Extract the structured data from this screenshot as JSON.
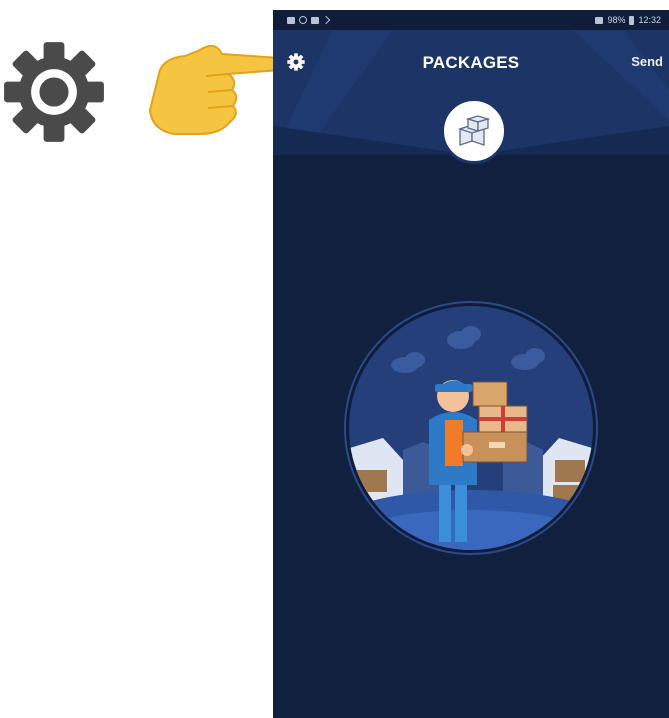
{
  "annotation": {
    "pointer_icon": "pointing-hand-icon",
    "gear_icon": "gear-icon",
    "hand_color": "#f5c542",
    "gear_color": "#4a4a4a"
  },
  "status_bar": {
    "time": "12:32",
    "battery": "98%"
  },
  "header": {
    "title": "PACKAGES",
    "send_label": "Send",
    "settings_icon": "gear-icon",
    "logo_icon": "boxes-icon"
  },
  "colors": {
    "background": "#122040",
    "header": "#1c3566",
    "accent": "#2f63b8"
  },
  "illustration": {
    "subject": "delivery-person-with-packages"
  }
}
